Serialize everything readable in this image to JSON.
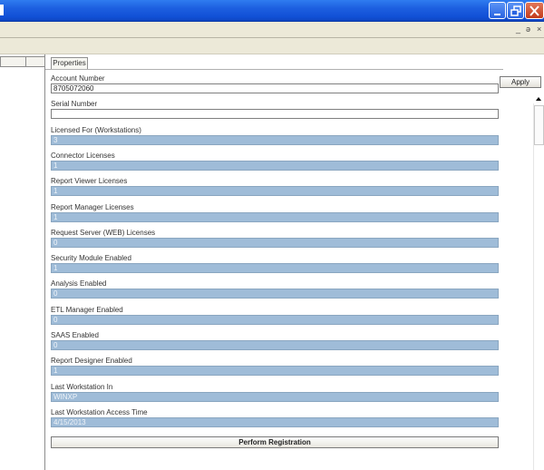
{
  "window": {
    "mdi_controls": [
      "_",
      "ə",
      "×"
    ]
  },
  "tabs": [
    "Properties"
  ],
  "apply_label": "Apply",
  "perform_label": "Perform Registration",
  "fields": [
    {
      "label": "Account Number",
      "value": "8705072060",
      "editable": true
    },
    {
      "label": "Serial Number",
      "value": "",
      "editable": true
    },
    {
      "label": "Licensed For (Workstations)",
      "value": "3",
      "editable": false
    },
    {
      "label": "Connector Licenses",
      "value": "1",
      "editable": false
    },
    {
      "label": "Report Viewer Licenses",
      "value": "1",
      "editable": false
    },
    {
      "label": "Report Manager Licenses",
      "value": "1",
      "editable": false
    },
    {
      "label": "Request Server (WEB) Licenses",
      "value": "0",
      "editable": false
    },
    {
      "label": "Security Module Enabled",
      "value": "1",
      "editable": false
    },
    {
      "label": "Analysis Enabled",
      "value": "0",
      "editable": false
    },
    {
      "label": "ETL Manager Enabled",
      "value": "0",
      "editable": false
    },
    {
      "label": "SAAS Enabled",
      "value": "0",
      "editable": false
    },
    {
      "label": "Report Designer Enabled",
      "value": "1",
      "editable": false
    },
    {
      "label": "Last Workstation In",
      "value": "WINXP",
      "editable": false
    },
    {
      "label": "Last Workstation Access Time",
      "value": "4/15/2013",
      "editable": false
    }
  ],
  "colors": {
    "titlebar": "#1d5fe0",
    "readonly_field": "#9fbcd8",
    "menubar": "#ece9d8"
  }
}
